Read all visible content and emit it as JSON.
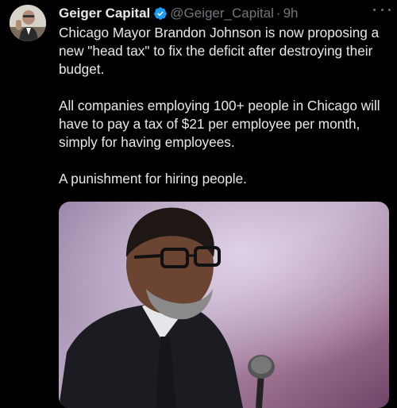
{
  "tweet": {
    "author_name": "Geiger Capital",
    "handle": "@Geiger_Capital",
    "separator": "·",
    "time": "9h",
    "paragraphs": [
      "Chicago Mayor Brandon Johnson is now proposing a new \"head tax\" to fix the deficit after destroying their budget.",
      "All companies employing 100+ people in Chicago will have to pay a tax of $21 per employee per month, simply for having employees.",
      "A punishment for hiring people."
    ],
    "verified_color": "#1d9bf0",
    "icons": {
      "verified": "verified-badge-icon",
      "more": "more-options-icon"
    }
  }
}
